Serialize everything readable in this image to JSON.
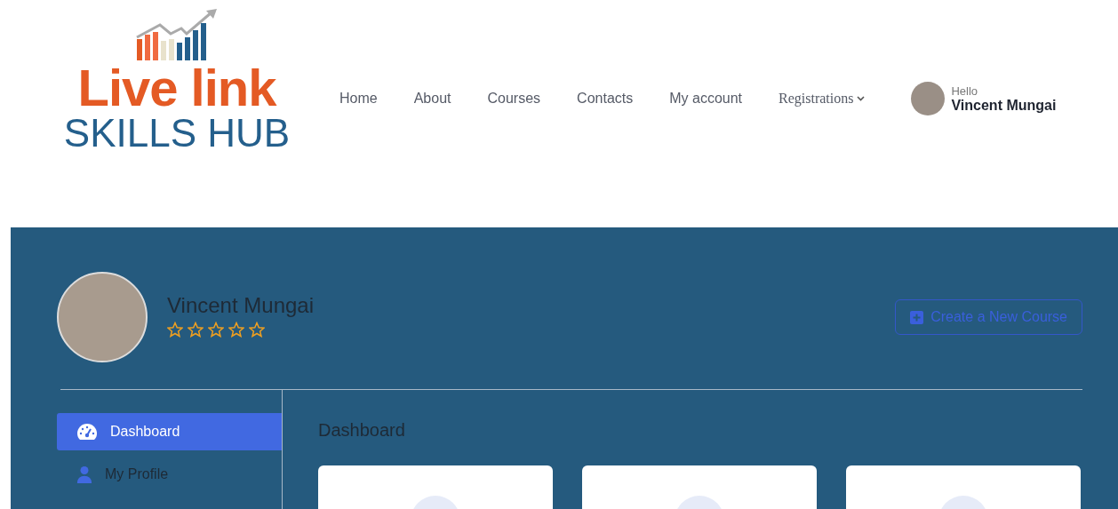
{
  "logo": {
    "line_1": "Live link",
    "line_2": "SKILLS HUB"
  },
  "nav": [
    {
      "label": "Home",
      "kind": "link"
    },
    {
      "label": "About",
      "kind": "link"
    },
    {
      "label": "Courses",
      "kind": "link"
    },
    {
      "label": "Contacts",
      "kind": "link"
    },
    {
      "label": "My account",
      "kind": "link"
    },
    {
      "label": "Registrations",
      "kind": "dropdown"
    }
  ],
  "user_menu": {
    "greeting": "Hello",
    "name": "Vincent Mungai"
  },
  "profile": {
    "name": "Vincent Mungai",
    "stars": 0,
    "create_button": "Create a New Course"
  },
  "sidebar": {
    "items": [
      {
        "label": "Dashboard",
        "kind": "gauge",
        "selected": true
      },
      {
        "label": "My Profile",
        "kind": "person",
        "selected": false
      }
    ]
  },
  "content": {
    "title": "Dashboard"
  }
}
